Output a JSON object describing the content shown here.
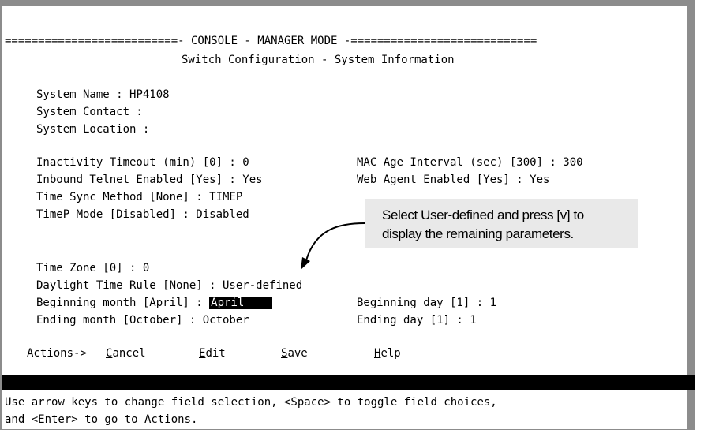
{
  "console": {
    "header_line": "==========================- CONSOLE - MANAGER MODE -============================",
    "title": "Switch Configuration - System Information"
  },
  "system": {
    "name_label": "System Name : ",
    "name_value": "HP4108",
    "contact_label": "System Contact :",
    "location_label": "System Location :"
  },
  "settings": {
    "inactivity": "Inactivity Timeout (min) [0] : 0",
    "mac_age": "MAC Age Interval (sec) [300] : 300",
    "telnet": "Inbound Telnet Enabled [Yes] : Yes",
    "web_agent": "Web Agent Enabled [Yes] : Yes",
    "time_sync": "Time Sync Method [None] : TIMEP",
    "timep_mode": "TimeP Mode [Disabled] : Disabled"
  },
  "time": {
    "zone": "Time Zone [0] : 0",
    "dst_rule": "Daylight Time Rule [None] : User-defined",
    "begin_month_label": "Beginning month [April] : ",
    "begin_month_value": "April    ",
    "begin_day": "Beginning day [1] : 1",
    "end_month": "Ending month [October] : October",
    "end_day": "Ending day [1] : 1"
  },
  "actions": {
    "label": "Actions->",
    "cancel_first": "C",
    "cancel_rest": "ancel",
    "edit_first": "E",
    "edit_rest": "dit",
    "save_first": "S",
    "save_rest": "ave",
    "help_first": "H",
    "help_rest": "elp"
  },
  "help_text": {
    "line1": "Use arrow keys to change field selection, <Space> to toggle field choices,",
    "line2": "and <Enter> to go to Actions."
  },
  "callout": {
    "line1": "Select User-defined and press [v] to",
    "line2": "display the remaining parameters."
  }
}
